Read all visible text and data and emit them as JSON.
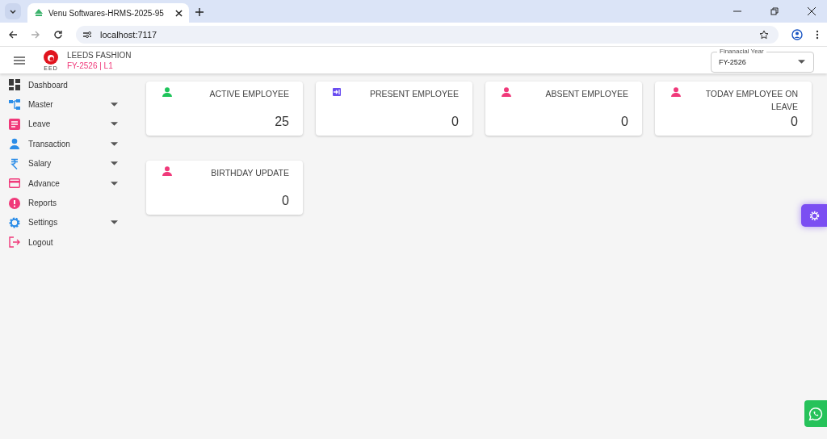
{
  "browser": {
    "tab_title": "Venu Softwares-HRMS-2025-95",
    "address": "localhost:7117"
  },
  "header": {
    "company": "LEEDS FASHION",
    "subtitle": "FY-2526 | L1",
    "logo_text": "EED",
    "financial_year": {
      "label": "Finanacial Year",
      "value": "FY-2526"
    }
  },
  "sidebar": {
    "items": [
      {
        "label": "Dashboard",
        "kind": "dashboard",
        "has_submenu": false
      },
      {
        "label": "Master",
        "kind": "master",
        "has_submenu": true
      },
      {
        "label": "Leave",
        "kind": "leave",
        "has_submenu": true
      },
      {
        "label": "Transaction",
        "kind": "transaction",
        "has_submenu": true
      },
      {
        "label": "Salary",
        "kind": "salary",
        "has_submenu": true
      },
      {
        "label": "Advance",
        "kind": "advance",
        "has_submenu": true
      },
      {
        "label": "Reports",
        "kind": "reports",
        "has_submenu": false
      },
      {
        "label": "Settings",
        "kind": "settings",
        "has_submenu": true
      },
      {
        "label": "Logout",
        "kind": "logout",
        "has_submenu": false
      }
    ]
  },
  "cards": [
    {
      "title": "ACTIVE EMPLOYEE",
      "value": "25",
      "kind": "person",
      "color": "#1ec45a"
    },
    {
      "title": "PRESENT EMPLOYEE",
      "value": "0",
      "kind": "login",
      "color": "#6a4df0"
    },
    {
      "title": "ABSENT EMPLOYEE",
      "value": "0",
      "kind": "person",
      "color": "#f0397a"
    },
    {
      "title": "TODAY EMPLOYEE ON LEAVE",
      "value": "0",
      "kind": "person",
      "color": "#f0397a"
    },
    {
      "title": "BIRTHDAY UPDATE",
      "value": "0",
      "kind": "person",
      "color": "#f0397a"
    }
  ]
}
